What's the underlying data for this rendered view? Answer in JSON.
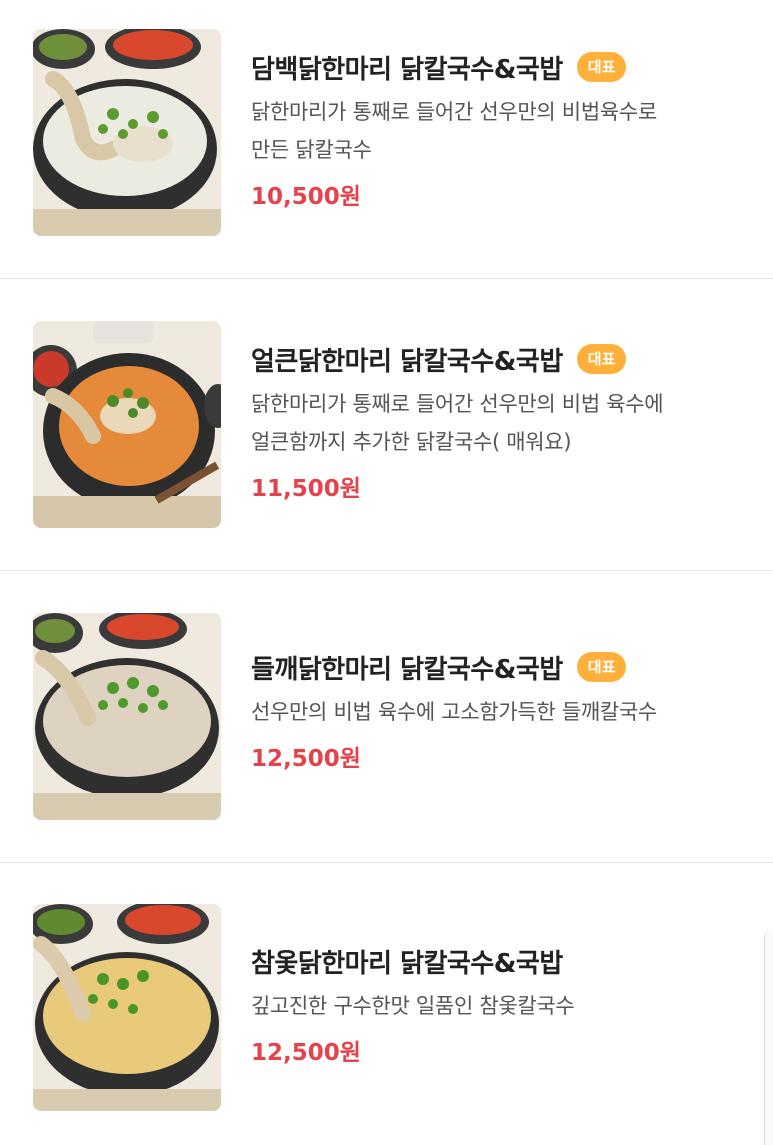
{
  "menu": {
    "items": [
      {
        "name": "담백닭한마리 닭칼국수&국밥",
        "badge": "대표",
        "desc_line1": "닭한마리가 통째로 들어간 선우만의 비법육수로",
        "desc_line2": "만든 닭칼국수",
        "price": "10,500원",
        "broth_color": "#ecebe2"
      },
      {
        "name": "얼큰닭한마리 닭칼국수&국밥",
        "badge": "대표",
        "desc_line1": "닭한마리가 통째로 들어간 선우만의 비법 육수에",
        "desc_line2": "얼큰함까지 추가한 닭칼국수( 매워요)",
        "price": "11,500원",
        "broth_color": "#e58a3a"
      },
      {
        "name": "들깨닭한마리 닭칼국수&국밥",
        "badge": "대표",
        "desc_line1": "선우만의 비법 육수에 고소함가득한 들깨칼국수",
        "desc_line2": "",
        "price": "12,500원",
        "broth_color": "#ddd3c0"
      },
      {
        "name": "참옻닭한마리 닭칼국수&국밥",
        "badge": "",
        "desc_line1": "깊고진한 구수한맛 일품인 참옻칼국수",
        "desc_line2": "",
        "price": "12,500원",
        "broth_color": "#e9c97a"
      }
    ]
  },
  "colors": {
    "badge_bg": "#ffb03b",
    "price": "#e5434b",
    "title": "#222222",
    "desc": "#555555"
  }
}
